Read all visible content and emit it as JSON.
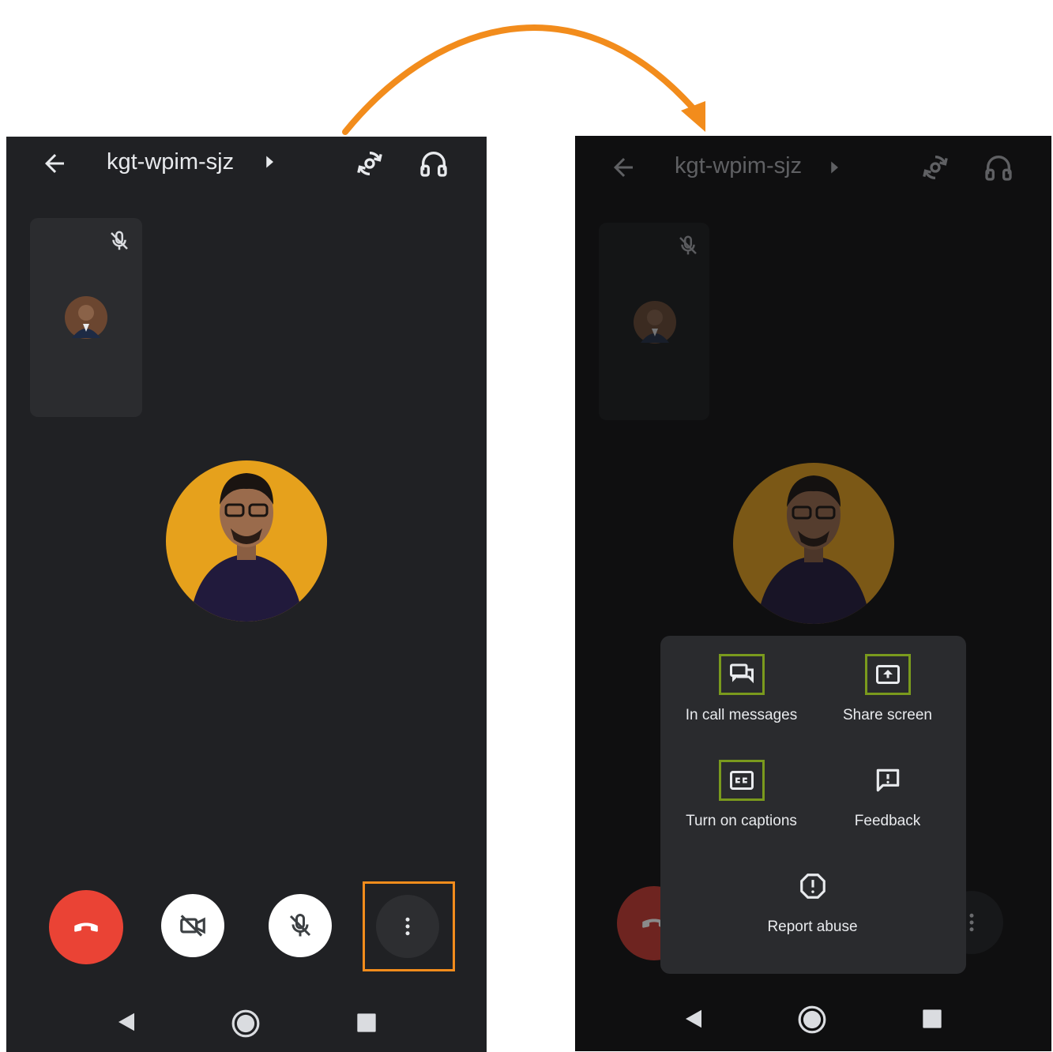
{
  "left_screen": {
    "meeting_code": "kgt-wpim-sjz",
    "back_icon": "back-arrow-icon",
    "switch_camera_icon": "switch-camera-icon",
    "audio_icon": "headphones-icon",
    "controls": [
      {
        "name": "end-call",
        "color": "#ea4335",
        "icon": "phone-hangup-icon"
      },
      {
        "name": "camera-off",
        "color": "#ffffff",
        "icon": "video-off-icon"
      },
      {
        "name": "mic-off",
        "color": "#ffffff",
        "icon": "mic-off-icon"
      },
      {
        "name": "more-options",
        "color": "#2d2e31",
        "icon": "more-vert-icon"
      }
    ]
  },
  "right_screen": {
    "meeting_code": "kgt-wpim-sjz",
    "menu": {
      "items": [
        {
          "label": "In call messages",
          "icon": "chat-icon",
          "highlighted": true
        },
        {
          "label": "Share screen",
          "icon": "present-to-all-icon",
          "highlighted": true
        },
        {
          "label": "Turn on captions",
          "icon": "closed-caption-icon",
          "highlighted": true
        },
        {
          "label": "Feedback",
          "icon": "feedback-icon",
          "highlighted": false
        },
        {
          "label": "Report abuse",
          "icon": "report-icon",
          "highlighted": false
        }
      ]
    }
  },
  "colors": {
    "accent_orange": "#f28c1c",
    "avatar_bg": "#e6a11c",
    "highlight_green": "#7a9a1d",
    "end_call_red": "#ea4335"
  }
}
